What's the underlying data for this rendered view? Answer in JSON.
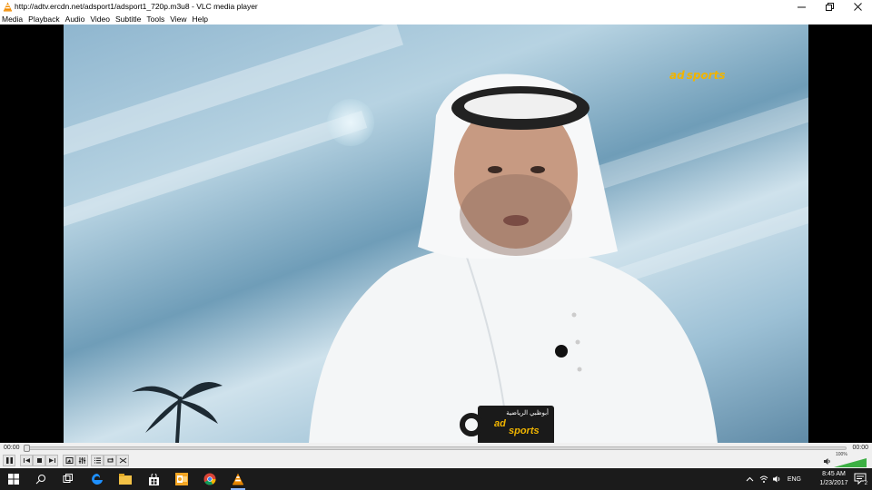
{
  "window": {
    "title": "http://adtv.ercdn.net/adsport1/adsport1_720p.m3u8 - VLC media player",
    "icon": "vlc-cone-icon"
  },
  "menu": {
    "items": [
      "Media",
      "Playback",
      "Audio",
      "Video",
      "Subtitle",
      "Tools",
      "View",
      "Help"
    ]
  },
  "player": {
    "elapsed": "00:00",
    "total": "00:00",
    "progress_fraction": 0.0,
    "volume_percent": "100%",
    "volume_level": 1.0
  },
  "overlay": {
    "channel_logo_ad": "ad",
    "channel_logo_sports": "sports",
    "mug_text_ar": "أبوظبي الرياضية",
    "mug_ad": "ad",
    "mug_sports": "sports"
  },
  "taskbar": {
    "language": "ENG",
    "time": "8:45 AM",
    "date": "1/23/2017",
    "notification_count": "2"
  },
  "colors": {
    "accent_vlc": "#f28c00",
    "seek_bg": "#d8d8d8",
    "taskbar_bg": "#1b1b1b",
    "volume_green": "#3cb043"
  }
}
